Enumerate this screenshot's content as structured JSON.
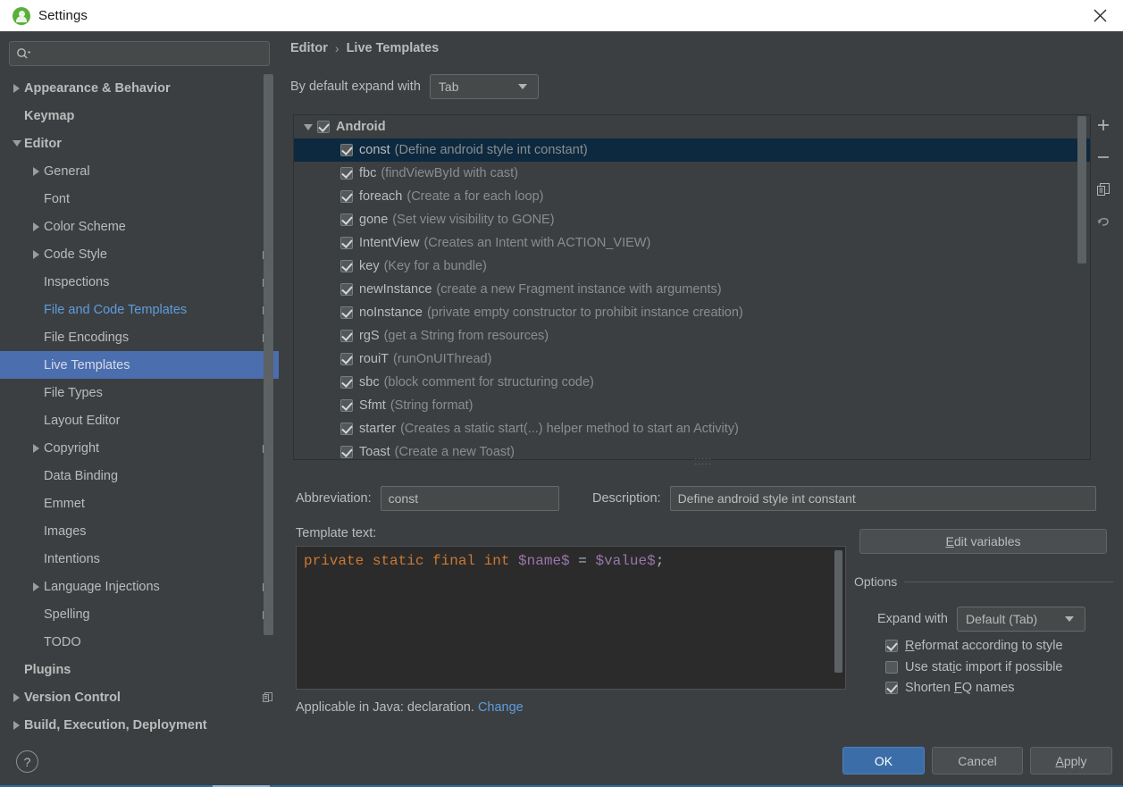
{
  "window": {
    "title": "Settings",
    "app_icon": "android-studio-icon",
    "close_icon": "close-icon"
  },
  "sidebar": {
    "search": {
      "placeholder": "",
      "value": "",
      "icon": "search-icon"
    },
    "items": [
      {
        "label": "Appearance & Behavior",
        "indent": 0,
        "arrow": "right",
        "bold": true,
        "copy": false,
        "selected": false,
        "modified": false
      },
      {
        "label": "Keymap",
        "indent": 0,
        "arrow": "none",
        "bold": true,
        "copy": false,
        "selected": false,
        "modified": false
      },
      {
        "label": "Editor",
        "indent": 0,
        "arrow": "down",
        "bold": true,
        "copy": false,
        "selected": false,
        "modified": false
      },
      {
        "label": "General",
        "indent": 1,
        "arrow": "right",
        "bold": false,
        "copy": false,
        "selected": false,
        "modified": false
      },
      {
        "label": "Font",
        "indent": 1,
        "arrow": "none",
        "bold": false,
        "copy": false,
        "selected": false,
        "modified": false
      },
      {
        "label": "Color Scheme",
        "indent": 1,
        "arrow": "right",
        "bold": false,
        "copy": false,
        "selected": false,
        "modified": false
      },
      {
        "label": "Code Style",
        "indent": 1,
        "arrow": "right",
        "bold": false,
        "copy": true,
        "selected": false,
        "modified": false
      },
      {
        "label": "Inspections",
        "indent": 1,
        "arrow": "none",
        "bold": false,
        "copy": true,
        "selected": false,
        "modified": false
      },
      {
        "label": "File and Code Templates",
        "indent": 1,
        "arrow": "none",
        "bold": false,
        "copy": true,
        "selected": false,
        "modified": true
      },
      {
        "label": "File Encodings",
        "indent": 1,
        "arrow": "none",
        "bold": false,
        "copy": true,
        "selected": false,
        "modified": false
      },
      {
        "label": "Live Templates",
        "indent": 1,
        "arrow": "none",
        "bold": false,
        "copy": false,
        "selected": true,
        "modified": false
      },
      {
        "label": "File Types",
        "indent": 1,
        "arrow": "none",
        "bold": false,
        "copy": false,
        "selected": false,
        "modified": false
      },
      {
        "label": "Layout Editor",
        "indent": 1,
        "arrow": "none",
        "bold": false,
        "copy": false,
        "selected": false,
        "modified": false
      },
      {
        "label": "Copyright",
        "indent": 1,
        "arrow": "right",
        "bold": false,
        "copy": true,
        "selected": false,
        "modified": false
      },
      {
        "label": "Data Binding",
        "indent": 1,
        "arrow": "none",
        "bold": false,
        "copy": false,
        "selected": false,
        "modified": false
      },
      {
        "label": "Emmet",
        "indent": 1,
        "arrow": "none",
        "bold": false,
        "copy": false,
        "selected": false,
        "modified": false
      },
      {
        "label": "Images",
        "indent": 1,
        "arrow": "none",
        "bold": false,
        "copy": false,
        "selected": false,
        "modified": false
      },
      {
        "label": "Intentions",
        "indent": 1,
        "arrow": "none",
        "bold": false,
        "copy": false,
        "selected": false,
        "modified": false
      },
      {
        "label": "Language Injections",
        "indent": 1,
        "arrow": "right",
        "bold": false,
        "copy": true,
        "selected": false,
        "modified": false
      },
      {
        "label": "Spelling",
        "indent": 1,
        "arrow": "none",
        "bold": false,
        "copy": true,
        "selected": false,
        "modified": false
      },
      {
        "label": "TODO",
        "indent": 1,
        "arrow": "none",
        "bold": false,
        "copy": false,
        "selected": false,
        "modified": false
      },
      {
        "label": "Plugins",
        "indent": 0,
        "arrow": "none",
        "bold": true,
        "copy": false,
        "selected": false,
        "modified": false
      },
      {
        "label": "Version Control",
        "indent": 0,
        "arrow": "right",
        "bold": true,
        "copy": true,
        "selected": false,
        "modified": false
      },
      {
        "label": "Build, Execution, Deployment",
        "indent": 0,
        "arrow": "right",
        "bold": true,
        "copy": false,
        "selected": false,
        "modified": false
      }
    ]
  },
  "main": {
    "breadcrumb": {
      "parent": "Editor",
      "separator": "›",
      "current": "Live Templates"
    },
    "expand_default": {
      "label": "By default expand with",
      "value": "Tab",
      "icon": "chevron-down-icon"
    },
    "tree": {
      "group": {
        "label": "Android",
        "checked": true,
        "expanded": true
      },
      "templates": [
        {
          "abbr": "const",
          "desc": "(Define android style int constant)",
          "checked": true,
          "selected": true
        },
        {
          "abbr": "fbc",
          "desc": "(findViewById with cast)",
          "checked": true,
          "selected": false
        },
        {
          "abbr": "foreach",
          "desc": "(Create a for each loop)",
          "checked": true,
          "selected": false
        },
        {
          "abbr": "gone",
          "desc": "(Set view visibility to GONE)",
          "checked": true,
          "selected": false
        },
        {
          "abbr": "IntentView",
          "desc": "(Creates an Intent with ACTION_VIEW)",
          "checked": true,
          "selected": false
        },
        {
          "abbr": "key",
          "desc": "(Key for a bundle)",
          "checked": true,
          "selected": false
        },
        {
          "abbr": "newInstance",
          "desc": "(create a new Fragment instance with arguments)",
          "checked": true,
          "selected": false
        },
        {
          "abbr": "noInstance",
          "desc": "(private empty constructor to prohibit instance creation)",
          "checked": true,
          "selected": false
        },
        {
          "abbr": "rgS",
          "desc": "(get a String from resources)",
          "checked": true,
          "selected": false
        },
        {
          "abbr": "rouiT",
          "desc": "(runOnUIThread)",
          "checked": true,
          "selected": false
        },
        {
          "abbr": "sbc",
          "desc": "(block comment for structuring code)",
          "checked": true,
          "selected": false
        },
        {
          "abbr": "Sfmt",
          "desc": "(String format)",
          "checked": true,
          "selected": false
        },
        {
          "abbr": "starter",
          "desc": "(Creates a static start(...) helper method to start an Activity)",
          "checked": true,
          "selected": false
        },
        {
          "abbr": "Toast",
          "desc": "(Create a new Toast)",
          "checked": true,
          "selected": false
        }
      ]
    },
    "toolbar": [
      {
        "name": "add-template-button",
        "icon": "plus-icon"
      },
      {
        "name": "remove-template-button",
        "icon": "minus-icon"
      },
      {
        "name": "duplicate-template-button",
        "icon": "copy-icon"
      },
      {
        "name": "revert-template-button",
        "icon": "undo-icon"
      }
    ],
    "form": {
      "abbreviation_label": "Abbreviation:",
      "abbreviation_value": "const",
      "description_label": "Description:",
      "description_value": "Define android style int constant",
      "template_text_label": "Template text:",
      "template_code": {
        "tokens": [
          {
            "t": "private static final int ",
            "c": "kw"
          },
          {
            "t": "$name$",
            "c": "var"
          },
          {
            "t": " = ",
            "c": "pl"
          },
          {
            "t": "$value$",
            "c": "var"
          },
          {
            "t": ";",
            "c": "pl"
          }
        ],
        "plain": "private static final int $name$ = $value$;"
      },
      "applicable_text": "Applicable in Java: declaration.",
      "applicable_link": "Change"
    },
    "options": {
      "edit_variables_button": "Edit variables",
      "edit_variables_mnemonic": "E",
      "group_title": "Options",
      "expand_with_label": "Expand with",
      "expand_with_value": "Default (Tab)",
      "checkboxes": [
        {
          "label": "Reformat according to style",
          "mnemonic": "R",
          "checked": true
        },
        {
          "label": "Use static import if possible",
          "mnemonic": "i",
          "checked": false
        },
        {
          "label": "Shorten FQ names",
          "mnemonic": "F",
          "checked": true
        }
      ]
    }
  },
  "footer": {
    "help_label": "?",
    "ok_label": "OK",
    "cancel_label": "Cancel",
    "apply_label": "Apply"
  },
  "colors": {
    "window_bg": "#3c3f41",
    "selection_blue": "#4b6eaf",
    "row_selection": "#0d293f",
    "link_blue": "#5c9ede",
    "ok_blue": "#3b6ea8",
    "code_keyword": "#cc7832",
    "code_variable": "#9876aa",
    "editor_bg": "#2b2b2b"
  }
}
